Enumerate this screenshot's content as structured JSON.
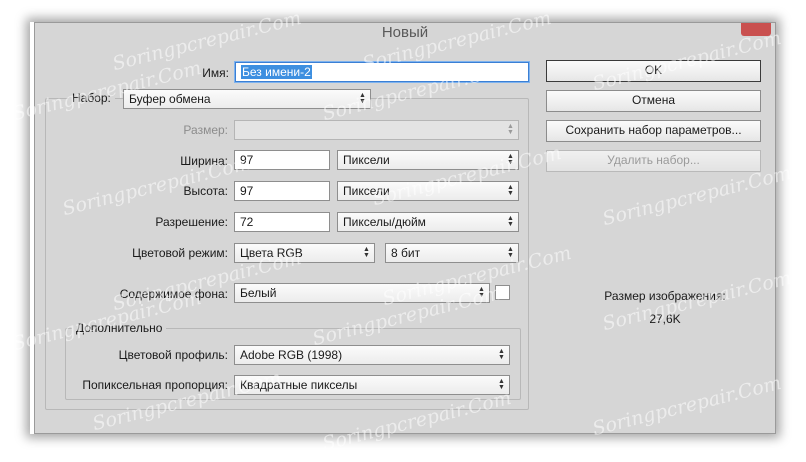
{
  "dialog": {
    "title": "Новый"
  },
  "fields": {
    "name": {
      "label": "Имя:",
      "value": "Без имени-2"
    },
    "preset": {
      "label": "Набор:",
      "value": "Буфер обмена"
    },
    "size": {
      "label": "Размер:",
      "value": ""
    },
    "width": {
      "label": "Ширина:",
      "value": "97",
      "unit": "Пиксели"
    },
    "height": {
      "label": "Высота:",
      "value": "97",
      "unit": "Пиксели"
    },
    "resolution": {
      "label": "Разрешение:",
      "value": "72",
      "unit": "Пикселы/дюйм"
    },
    "color_mode": {
      "label": "Цветовой режим:",
      "value": "Цвета RGB",
      "depth": "8 бит"
    },
    "background": {
      "label": "Содержимое фона:",
      "value": "Белый"
    }
  },
  "advanced": {
    "legend": "Дополнительно",
    "color_profile": {
      "label": "Цветовой профиль:",
      "value": "Adobe RGB (1998)"
    },
    "pixel_aspect": {
      "label": "Попиксельная пропорция:",
      "value": "Квадратные пикселы"
    }
  },
  "buttons": {
    "ok": "OK",
    "cancel": "Отмена",
    "save_preset": "Сохранить набор параметров...",
    "delete_preset": "Удалить набор..."
  },
  "info": {
    "image_size_label": "Размер изображения:",
    "image_size_value": "27,6K"
  },
  "watermark": "Soringpcrepair.Com",
  "colors": {
    "dialog_bg": "#d6d6d6",
    "focus_border": "#3b7fd4",
    "selection": "#3d8fe0",
    "close_button": "#c9504f"
  }
}
